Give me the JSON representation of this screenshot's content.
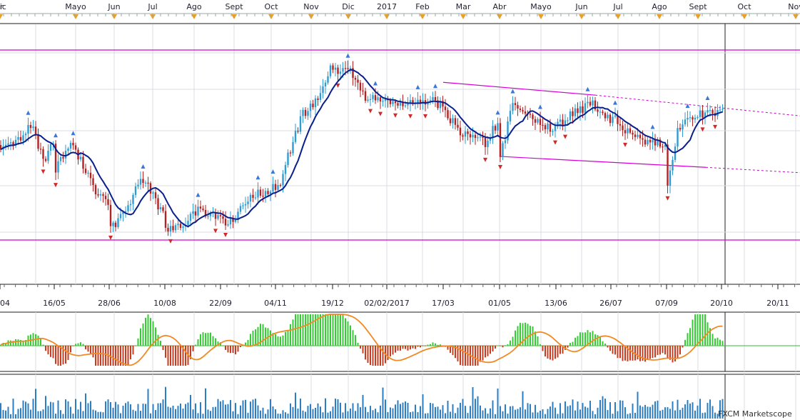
{
  "watermark": "FXCM Marketscope",
  "colors": {
    "bull_candle": "#2f9bd3",
    "bear_candle": "#b22222",
    "ma_line": "#0a1f8c",
    "channel": "#d400d4",
    "osc_pos": "#33cc33",
    "osc_neg": "#c83b1e",
    "signal": "#f08a24",
    "zero_line": "#33bb33",
    "volume": "#2a7fc4",
    "month_marker": "#e8a02a",
    "grid": "#d9dce3"
  },
  "chart_data": {
    "type": "candlestick",
    "month_axis": [
      "Mayo",
      "Jun",
      "Jul",
      "Ago",
      "Sept",
      "Oct",
      "Nov",
      "Dic",
      "2017",
      "Feb",
      "Mar",
      "Abr",
      "Mayo",
      "Jun",
      "Jul",
      "Ago",
      "Sept",
      "Oct",
      "Nov"
    ],
    "date_axis": [
      "16/05",
      "28/06",
      "10/08",
      "22/09",
      "04/11",
      "19/12",
      "02/02/2017",
      "17/03",
      "01/05",
      "13/06",
      "26/07",
      "07/09",
      "20/10",
      "20/11"
    ],
    "price_path": [
      [
        "04",
        0.5
      ],
      [
        "16/05",
        0.65
      ],
      [
        "28/06",
        0.95
      ],
      [
        "10/08",
        0.96
      ],
      [
        "22/09",
        0.88
      ],
      [
        "04/11",
        0.78
      ],
      [
        "19/12",
        0.1
      ],
      [
        "02/02/2017",
        0.28
      ],
      [
        "17/03",
        0.32
      ],
      [
        "01/05",
        0.58
      ],
      [
        "13/06",
        0.4
      ],
      [
        "26/07",
        0.32
      ],
      [
        "07/09",
        0.72
      ],
      [
        "20/10",
        0.3
      ]
    ],
    "horizontal_levels": [
      0.0,
      1.0
    ],
    "trend_channel": {
      "upper": [
        [
          "17/03",
          0.17
        ],
        [
          "13/06",
          0.23
        ],
        [
          "20/10",
          0.3
        ]
      ],
      "lower": [
        [
          "01/05",
          0.56
        ],
        [
          "07/09",
          0.61
        ],
        [
          "20/10",
          0.63
        ]
      ]
    },
    "panels": [
      "price",
      "oscillator",
      "volume"
    ]
  }
}
